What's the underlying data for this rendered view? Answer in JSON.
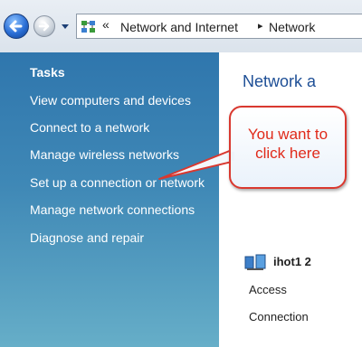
{
  "nav": {
    "back_icon": "back-arrow-icon",
    "forward_icon": "forward-arrow-icon",
    "address": {
      "icon": "network-folder-icon",
      "overflow_glyph": "«",
      "separator_glyph": "▸",
      "crumbs": [
        "Network and Internet",
        "Network"
      ]
    }
  },
  "taskpane": {
    "title": "Tasks",
    "tasks": [
      "View computers and devices",
      "Connect to a network",
      "Manage wireless networks",
      "Set up a connection or network",
      "Manage network connections",
      "Diagnose and repair"
    ]
  },
  "content": {
    "title": "Network a",
    "network_name": "ihot1  2",
    "rows": [
      "Access",
      "Connection"
    ]
  },
  "callout": {
    "text_line1": "You want to",
    "text_line2": "click here",
    "color": "#e02a1a"
  },
  "colors": {
    "pane_top": "#2f76ad",
    "pane_bottom": "#66aec8",
    "title_blue": "#1e4f96"
  }
}
